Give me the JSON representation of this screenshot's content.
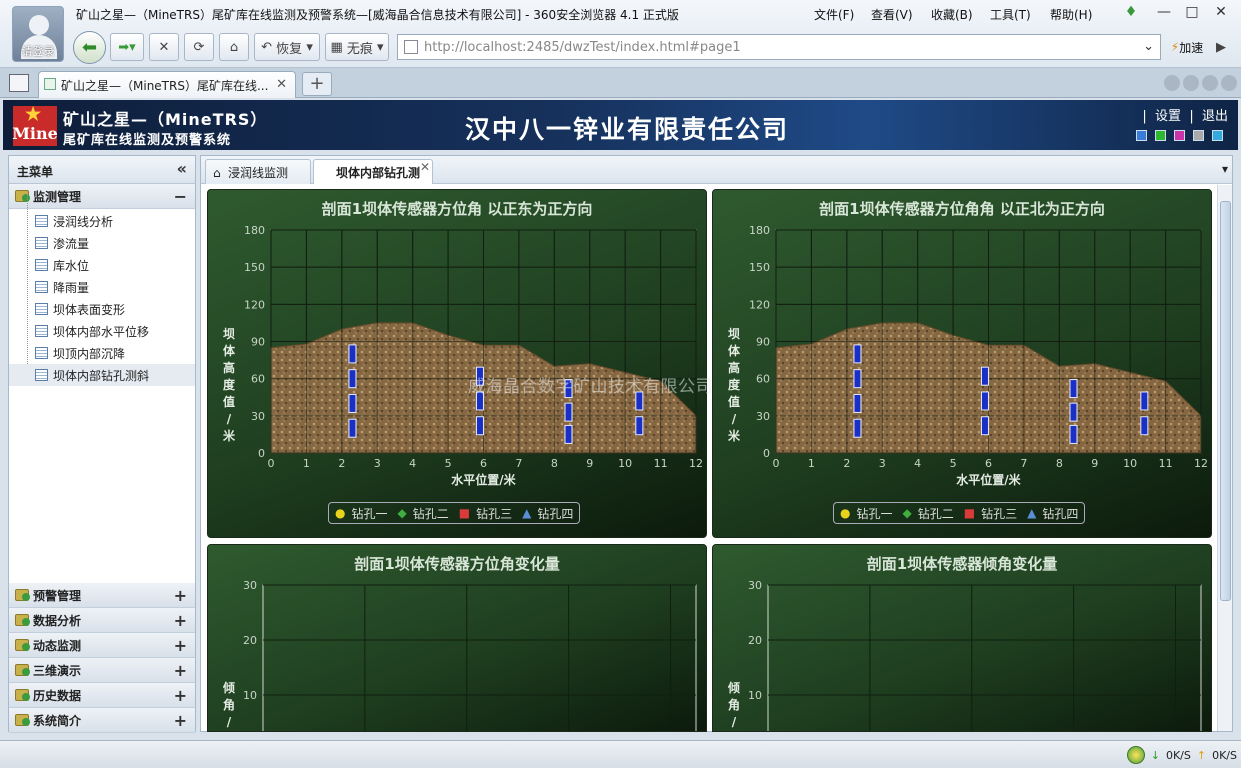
{
  "browser": {
    "avatar_label": "请登录",
    "window_title": "矿山之星—（MineTRS）尾矿库在线监测及预警系统—[威海晶合信息技术有限公司] - 360安全浏览器 4.1 正式版",
    "menu": [
      "文件(F)",
      "查看(V)",
      "收藏(B)",
      "工具(T)",
      "帮助(H)"
    ],
    "restore_label": "恢复",
    "notrace_label": "无痕",
    "url": "http://localhost:2485/dwzTest/index.html#page1",
    "accel_label": "加速",
    "tab_title": "矿山之星—（MineTRS）尾矿库在线...",
    "status_down": "0K/S",
    "status_up": "0K/S"
  },
  "header": {
    "logo_text": "Mine",
    "brand_line1": "矿山之星—（MineTRS）",
    "brand_line2": "尾矿库在线监测及预警系统",
    "company": "汉中八一锌业有限责任公司",
    "link_settings": "设置",
    "link_logout": "退出",
    "theme_colors": [
      "#3a7bd5",
      "#2eb82e",
      "#cc33aa",
      "#aaaaaa",
      "#33aadd"
    ]
  },
  "sidebar": {
    "title": "主菜单",
    "sections": [
      {
        "label": "监测管理",
        "expanded": true,
        "items": [
          "浸润线分析",
          "渗流量",
          "库水位",
          "降雨量",
          "坝体表面变形",
          "坝体内部水平位移",
          "坝顶内部沉降",
          "坝体内部钻孔测斜"
        ],
        "selected": "坝体内部钻孔测斜"
      },
      {
        "label": "预警管理"
      },
      {
        "label": "数据分析"
      },
      {
        "label": "动态监测"
      },
      {
        "label": "三维演示"
      },
      {
        "label": "历史数据"
      },
      {
        "label": "系统简介"
      }
    ]
  },
  "content": {
    "tabs": [
      "浸润线监测",
      "坝体内部钻孔测"
    ],
    "active_tab": "坝体内部钻孔测",
    "watermark": "威海晶合数字矿山技术有限公司"
  },
  "chart_data": [
    {
      "type": "scatter",
      "title": "剖面1坝体传感器方位角  以正东为正方向",
      "xlabel": "水平位置/米",
      "ylabel": "坝体高度值/米",
      "xlim": [
        0,
        12
      ],
      "ylim": [
        0,
        180
      ],
      "xticks": [
        0,
        1,
        2,
        3,
        4,
        5,
        6,
        7,
        8,
        9,
        10,
        11,
        12
      ],
      "yticks": [
        0,
        30,
        60,
        90,
        120,
        150,
        180
      ],
      "dam_profile": [
        [
          0,
          85
        ],
        [
          1,
          88
        ],
        [
          2,
          100
        ],
        [
          3,
          105
        ],
        [
          4,
          105
        ],
        [
          5,
          95
        ],
        [
          6,
          87
        ],
        [
          7,
          87
        ],
        [
          8,
          70
        ],
        [
          9,
          72
        ],
        [
          10,
          65
        ],
        [
          11,
          58
        ],
        [
          12,
          30
        ]
      ],
      "boreholes": [
        {
          "x": 2.3,
          "y": [
            20,
            40,
            60,
            80
          ]
        },
        {
          "x": 5.9,
          "y": [
            22,
            42,
            62
          ]
        },
        {
          "x": 8.4,
          "y": [
            15,
            33,
            52
          ]
        },
        {
          "x": 10.4,
          "y": [
            22,
            42
          ]
        }
      ],
      "legend": [
        "钻孔一",
        "钻孔二",
        "钻孔三",
        "钻孔四"
      ],
      "legend_colors": [
        "#e8d21c",
        "#3fae3f",
        "#d93a3a",
        "#5a8fd6"
      ]
    },
    {
      "type": "scatter",
      "title": "剖面1坝体传感器方位角角  以正北为正方向",
      "xlabel": "水平位置/米",
      "ylabel": "坝体高度值/米",
      "xlim": [
        0,
        12
      ],
      "ylim": [
        0,
        180
      ],
      "xticks": [
        0,
        1,
        2,
        3,
        4,
        5,
        6,
        7,
        8,
        9,
        10,
        11,
        12
      ],
      "yticks": [
        0,
        30,
        60,
        90,
        120,
        150,
        180
      ],
      "dam_profile": [
        [
          0,
          85
        ],
        [
          1,
          88
        ],
        [
          2,
          100
        ],
        [
          3,
          105
        ],
        [
          4,
          105
        ],
        [
          5,
          95
        ],
        [
          6,
          87
        ],
        [
          7,
          87
        ],
        [
          8,
          70
        ],
        [
          9,
          72
        ],
        [
          10,
          65
        ],
        [
          11,
          58
        ],
        [
          12,
          30
        ]
      ],
      "boreholes": [
        {
          "x": 2.3,
          "y": [
            20,
            40,
            60,
            80
          ]
        },
        {
          "x": 5.9,
          "y": [
            22,
            42,
            62
          ]
        },
        {
          "x": 8.4,
          "y": [
            15,
            33,
            52
          ]
        },
        {
          "x": 10.4,
          "y": [
            22,
            42
          ]
        }
      ],
      "legend": [
        "钻孔一",
        "钻孔二",
        "钻孔三",
        "钻孔四"
      ],
      "legend_colors": [
        "#e8d21c",
        "#3fae3f",
        "#d93a3a",
        "#5a8fd6"
      ]
    },
    {
      "type": "line",
      "title": "剖面1坝体传感器方位角变化量",
      "ylabel": "倾角/度",
      "ylim": [
        0,
        30
      ],
      "yticks": [
        10,
        20,
        30
      ],
      "series": []
    },
    {
      "type": "line",
      "title": "剖面1坝体传感器倾角变化量",
      "ylabel": "倾角/度",
      "ylim": [
        0,
        30
      ],
      "yticks": [
        10,
        20,
        30
      ],
      "series": []
    }
  ]
}
